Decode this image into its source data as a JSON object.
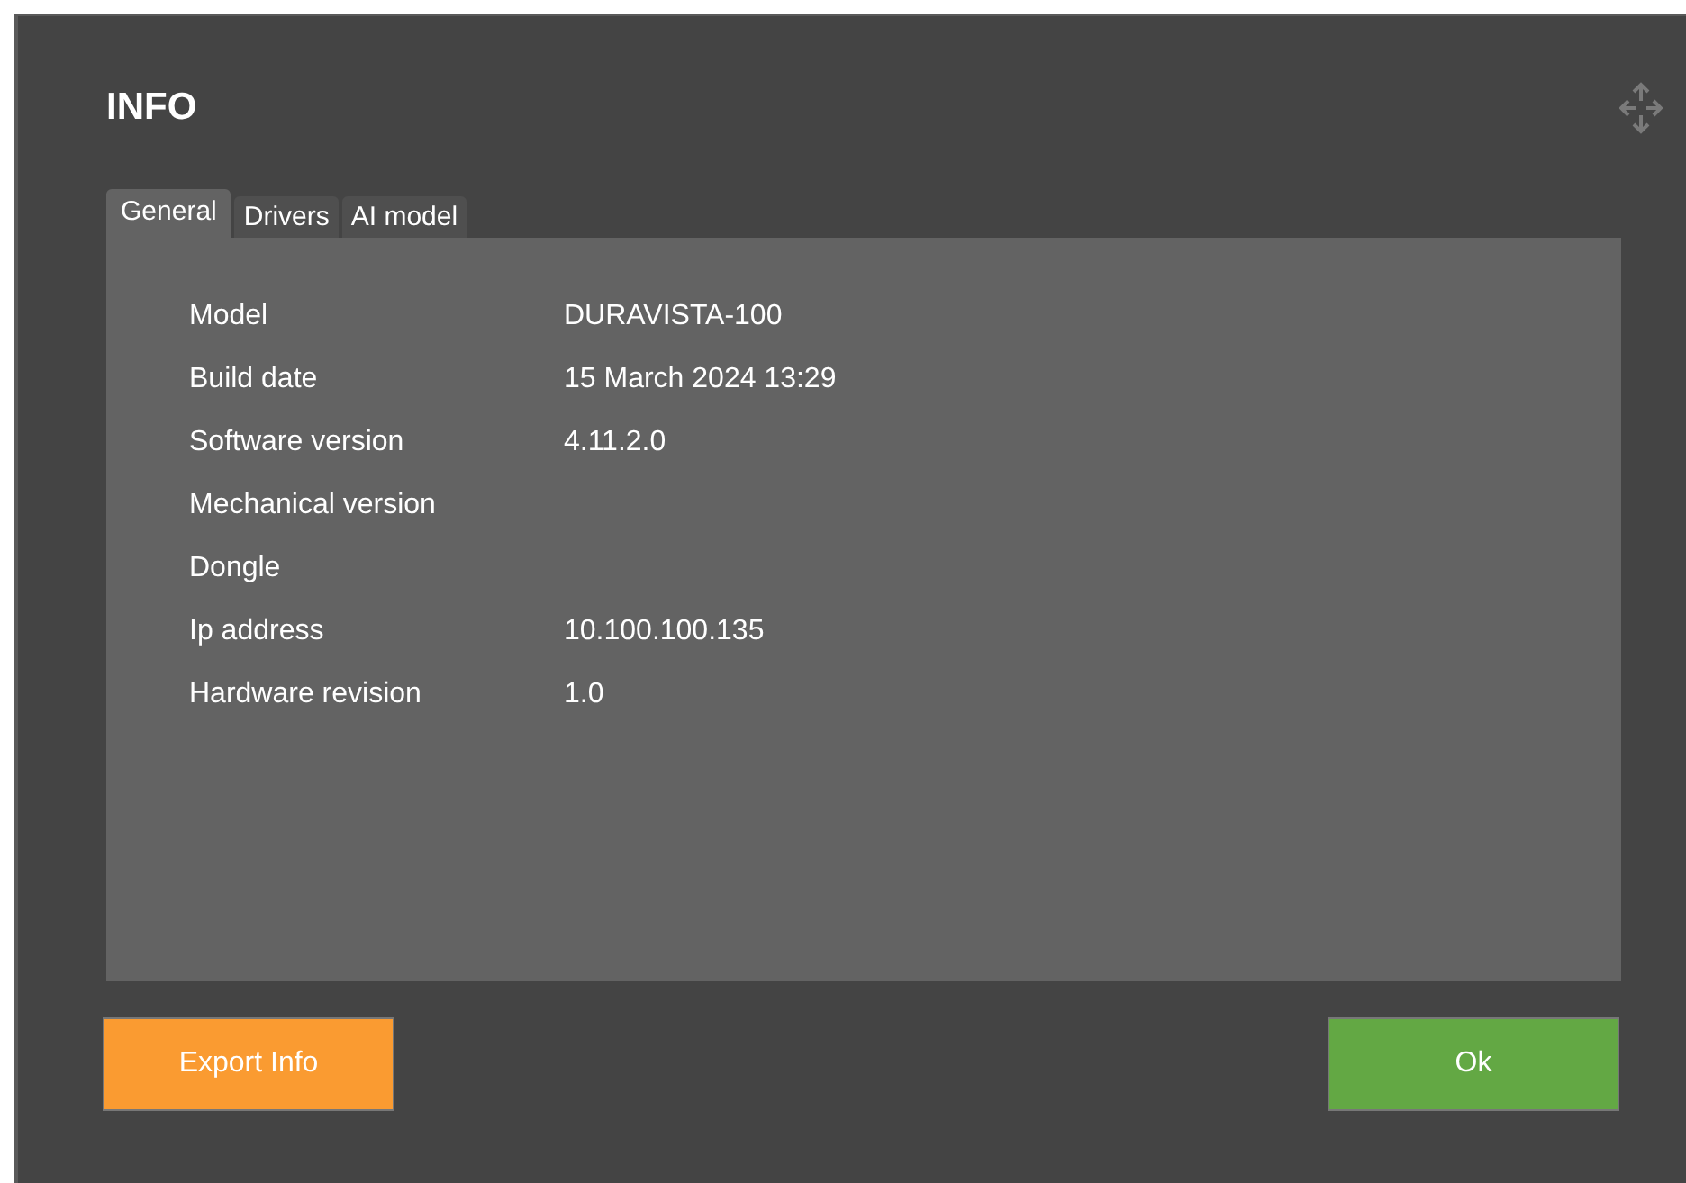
{
  "dialog": {
    "title": "INFO"
  },
  "tabs": [
    {
      "label": "General",
      "selected": true
    },
    {
      "label": "Drivers",
      "selected": false
    },
    {
      "label": "AI model",
      "selected": false
    }
  ],
  "fields": [
    {
      "label": "Model",
      "value": "DURAVISTA-100"
    },
    {
      "label": "Build date",
      "value": "15 March 2024 13:29"
    },
    {
      "label": "Software version",
      "value": "4.11.2.0"
    },
    {
      "label": "Mechanical version"
    },
    {
      "label": "Dongle"
    },
    {
      "label": "Ip address",
      "value": "10.100.100.135"
    },
    {
      "label": "Hardware revision",
      "value": "1.0"
    }
  ],
  "buttons": [
    {
      "label": "Export Info",
      "kind": "secondary"
    },
    {
      "label": "Ok",
      "kind": "primary"
    }
  ]
}
